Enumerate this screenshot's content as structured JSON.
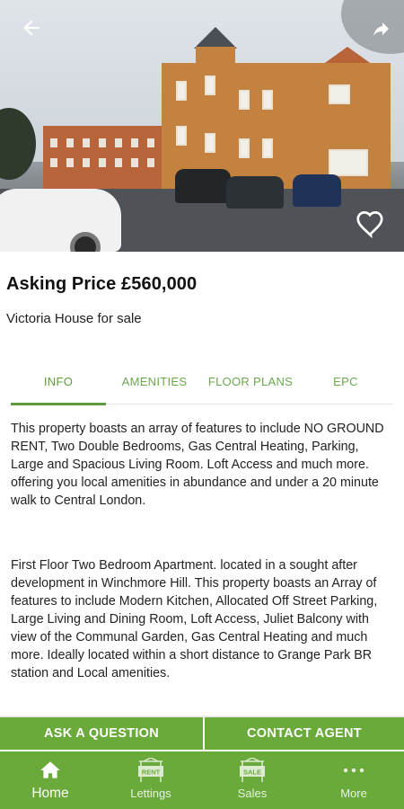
{
  "header": {
    "back_icon": "arrow-back-icon",
    "share_icon": "share-icon",
    "favorite_icon": "heart-outline-icon"
  },
  "listing": {
    "price": "Asking Price £560,000",
    "title": "Victoria House for sale"
  },
  "tabs": [
    {
      "label": "INFO",
      "active": true
    },
    {
      "label": "AMENITIES",
      "active": false
    },
    {
      "label": "FLOOR PLANS",
      "active": false
    },
    {
      "label": "EPC",
      "active": false
    }
  ],
  "description": {
    "paragraph1": "This property boasts an array of features to include NO GROUND RENT, Two Double Bedrooms, Gas Central Heating, Parking, Large and Spacious Living Room. Loft Access and much more. offering you local amenities in abundance and under a 20 minute walk to Central London.",
    "paragraph2": "First Floor Two Bedroom Apartment. located in a sought after development in Winchmore Hill. This property boasts an Array of features to include Modern Kitchen, Allocated Off Street Parking, Large Living and Dining Room, Loft Access, Juliet Balcony with view of the Communal Garden, Gas Central Heating and much more. Ideally located within a short distance to Grange Park BR station and Local amenities."
  },
  "actions": {
    "ask_question": "ASK A QUESTION",
    "contact_agent": "CONTACT AGENT"
  },
  "bottom_nav": [
    {
      "label": "Home",
      "icon": "home-icon",
      "active": true
    },
    {
      "label": "Lettings",
      "icon": "rent-sign-icon",
      "icon_text": "RENT",
      "active": false
    },
    {
      "label": "Sales",
      "icon": "sale-sign-icon",
      "icon_text": "SALE",
      "active": false
    },
    {
      "label": "More",
      "icon": "more-dots-icon",
      "active": false
    }
  ],
  "colors": {
    "accent_green": "#6aaa3a",
    "tab_green": "#5e9c3f"
  }
}
